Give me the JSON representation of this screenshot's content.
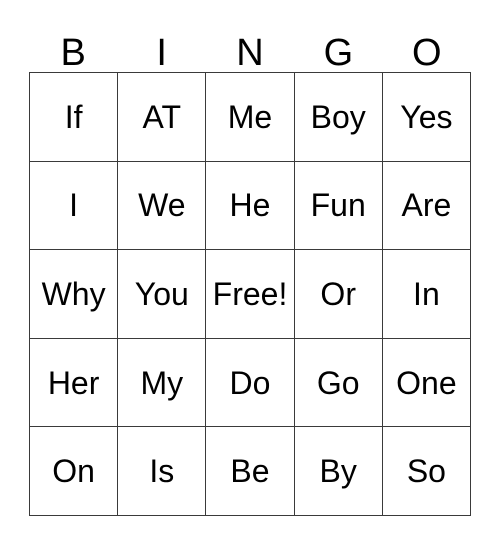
{
  "card": {
    "title": "BINGO",
    "header_letters": [
      "B",
      "I",
      "N",
      "G",
      "O"
    ],
    "columns": 5,
    "rows": 5,
    "free_space": {
      "label": "Free!",
      "row": 3,
      "column": 3
    },
    "colors": {
      "background": "#ffffff",
      "grid_line": "#3a3a3a",
      "text": "#000000"
    },
    "grid": [
      [
        "If",
        "AT",
        "Me",
        "Boy",
        "Yes"
      ],
      [
        "I",
        "We",
        "He",
        "Fun",
        "Are"
      ],
      [
        "Why",
        "You",
        "Free!",
        "Or",
        "In"
      ],
      [
        "Her",
        "My",
        "Do",
        "Go",
        "One"
      ],
      [
        "On",
        "Is",
        "Be",
        "By",
        "So"
      ]
    ]
  }
}
